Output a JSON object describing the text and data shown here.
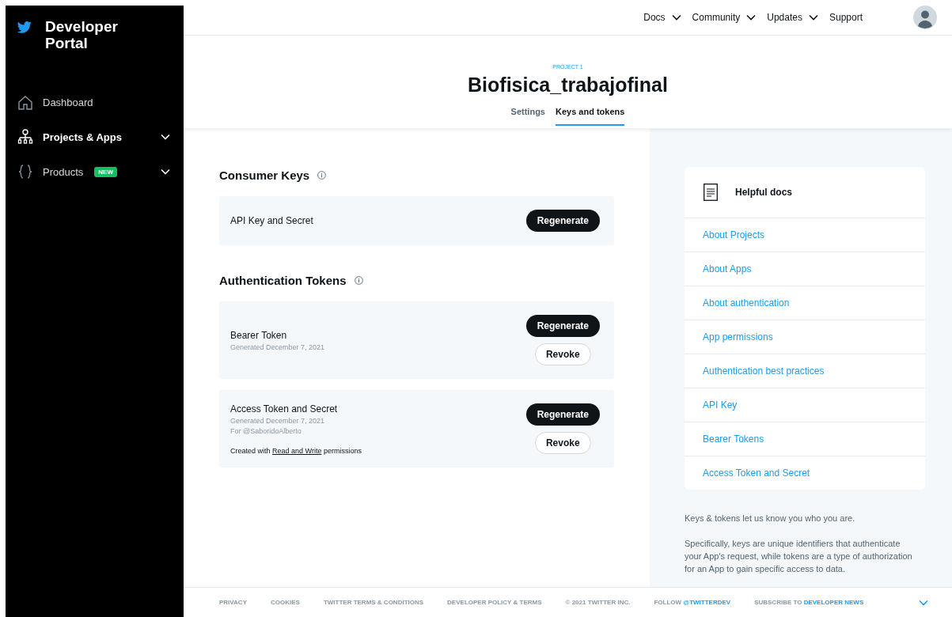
{
  "sidebar": {
    "title": "Developer Portal",
    "items": [
      {
        "label": "Dashboard",
        "selected": false,
        "expandable": false
      },
      {
        "label": "Projects & Apps",
        "selected": true,
        "expandable": true
      },
      {
        "label": "Products",
        "selected": false,
        "expandable": true,
        "badge": "NEW"
      }
    ]
  },
  "top_nav": [
    {
      "label": "Docs",
      "dropdown": true
    },
    {
      "label": "Community",
      "dropdown": true
    },
    {
      "label": "Updates",
      "dropdown": true
    },
    {
      "label": "Support",
      "dropdown": false
    }
  ],
  "header": {
    "eyebrow": "PROJECT 1",
    "title": "Biofisica_trabajofinal",
    "tabs": [
      {
        "label": "Settings",
        "selected": false
      },
      {
        "label": "Keys and tokens",
        "selected": true
      }
    ]
  },
  "sections": [
    {
      "title": "Consumer Keys",
      "cards": [
        {
          "title": "API Key and Secret",
          "buttons": [
            {
              "label": "Regenerate",
              "kind": "primary"
            }
          ]
        }
      ]
    },
    {
      "title": "Authentication Tokens",
      "cards": [
        {
          "title": "Bearer Token",
          "details": [
            "Generated December 7, 2021"
          ],
          "buttons": [
            {
              "label": "Regenerate",
              "kind": "primary"
            },
            {
              "label": "Revoke",
              "kind": "secondary"
            }
          ]
        },
        {
          "title": "Access Token and Secret",
          "details": [
            "Generated December 7, 2021",
            "For @SaboridoAlberto"
          ],
          "note": {
            "before": "Created with ",
            "link": "Read and Write",
            "after": " permissions"
          },
          "buttons": [
            {
              "label": "Regenerate",
              "kind": "primary"
            },
            {
              "label": "Revoke",
              "kind": "secondary"
            }
          ]
        }
      ]
    }
  ],
  "helpful_docs": {
    "title": "Helpful docs",
    "links": [
      "About Projects",
      "About Apps",
      "About authentication",
      "App permissions",
      "Authentication best practices",
      "API Key",
      "Bearer Tokens",
      "Access Token and Secret"
    ]
  },
  "description": [
    "Keys & tokens let us know you who you are.",
    "Specifically, keys are unique identifiers that authenticate your App's request, while tokens are a type of authorization for an App to gain specific access to data."
  ],
  "footer": [
    {
      "text": "PRIVACY"
    },
    {
      "text": "COOKIES"
    },
    {
      "text": "TWITTER TERMS & CONDITIONS"
    },
    {
      "text": "DEVELOPER POLICY & TERMS"
    },
    {
      "text": "© 2021 TWITTER INC."
    },
    {
      "text": "FOLLOW ",
      "link": "@TWITTERDEV"
    },
    {
      "text": "SUBSCRIBE TO ",
      "link": "DEVELOPER NEWS"
    }
  ]
}
